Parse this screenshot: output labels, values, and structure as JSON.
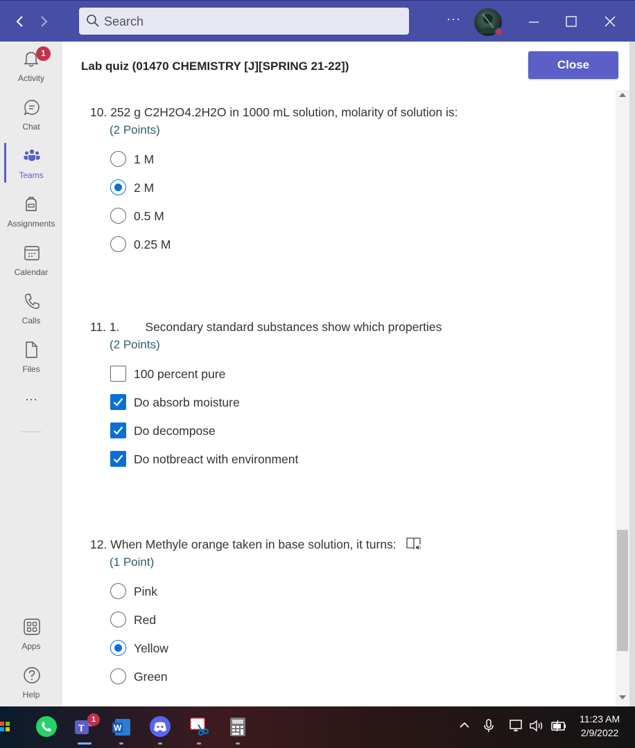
{
  "window": {
    "search_placeholder": "Search",
    "more_label": "···"
  },
  "rail": {
    "activity": {
      "label": "Activity",
      "badge": "1"
    },
    "chat": {
      "label": "Chat"
    },
    "teams": {
      "label": "Teams"
    },
    "assignments": {
      "label": "Assignments"
    },
    "calendar": {
      "label": "Calendar"
    },
    "calls": {
      "label": "Calls"
    },
    "files": {
      "label": "Files"
    },
    "more": {
      "label": "···"
    },
    "apps": {
      "label": "Apps"
    },
    "help": {
      "label": "Help"
    }
  },
  "panel": {
    "title": "Lab quiz (01470 CHEMISTRY [J][SPRING 21-22])",
    "close_label": "Close"
  },
  "questions": [
    {
      "number": "10.",
      "text": "252 g C2H2O4.2H2O in 1000 mL solution, molarity of solution is:",
      "points": "(2 Points)",
      "type": "radio",
      "options": [
        {
          "label": "1 M",
          "checked": false
        },
        {
          "label": "2 M",
          "checked": true
        },
        {
          "label": "0.5 M",
          "checked": false
        },
        {
          "label": "0.25 M",
          "checked": false
        }
      ]
    },
    {
      "number": "11.",
      "prefix": "1.",
      "text": "Secondary standard substances show which properties",
      "points": "(2 Points)",
      "type": "checkbox",
      "options": [
        {
          "label": "100 percent pure",
          "checked": false
        },
        {
          "label": "Do absorb moisture",
          "checked": true
        },
        {
          "label": "Do decompose",
          "checked": true
        },
        {
          "label": "Do notbreact with environment",
          "checked": true
        }
      ]
    },
    {
      "number": "12.",
      "text": "When Methyle orange taken in base solution, it turns:",
      "points": "(1 Point)",
      "type": "radio",
      "options": [
        {
          "label": "Pink",
          "checked": false
        },
        {
          "label": "Red",
          "checked": false
        },
        {
          "label": "Yellow",
          "checked": true
        },
        {
          "label": "Green",
          "checked": false
        }
      ]
    }
  ],
  "taskbar": {
    "teams_badge": "1",
    "time": "11:23 AM",
    "date": "2/9/2022"
  },
  "colors": {
    "titlebar": "#464ea6",
    "accent": "#5b5fc7",
    "selected": "#0b6fd9",
    "points": "#2b5d6e",
    "badge": "#c4314b"
  }
}
